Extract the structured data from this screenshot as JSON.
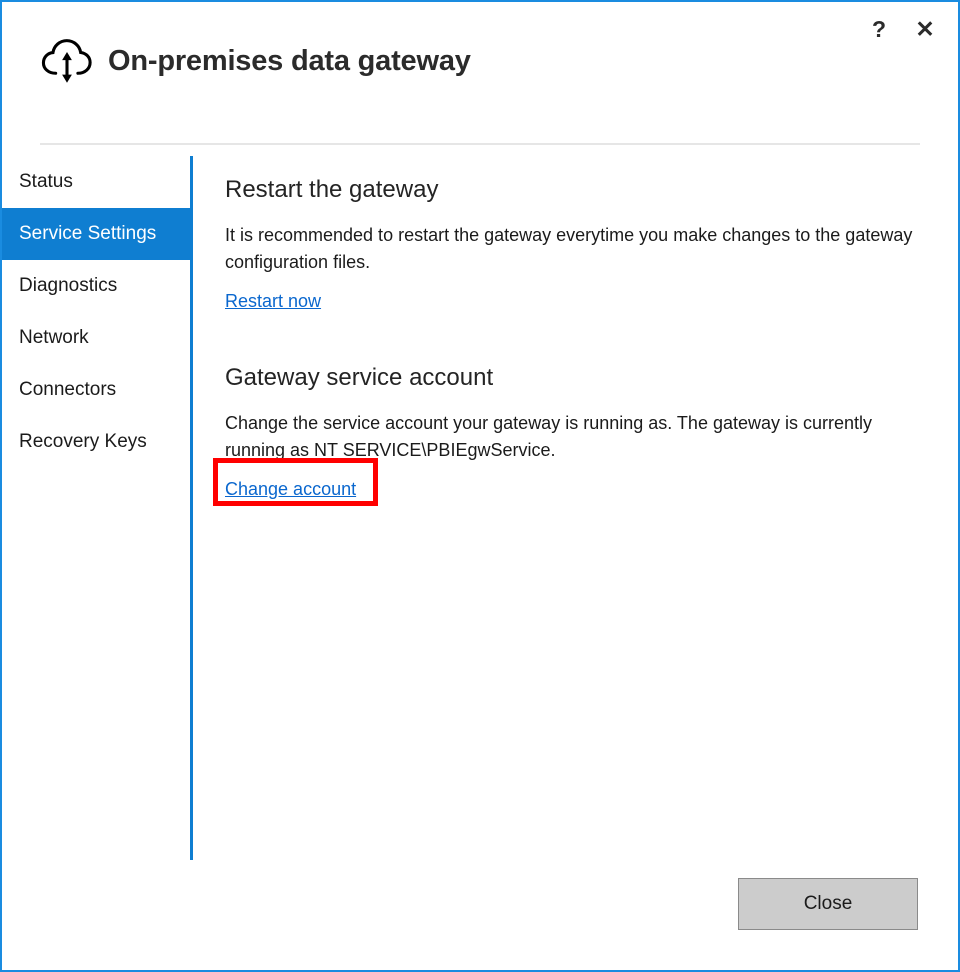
{
  "window": {
    "title": "On-premises data gateway",
    "icon": "cloud-updown-arrow-icon",
    "border_color": "#1a8ce0",
    "help_label": "?",
    "close_label": "✕"
  },
  "sidebar": {
    "items": [
      {
        "label": "Status",
        "selected": false
      },
      {
        "label": "Service Settings",
        "selected": true
      },
      {
        "label": "Diagnostics",
        "selected": false
      },
      {
        "label": "Network",
        "selected": false
      },
      {
        "label": "Connectors",
        "selected": false
      },
      {
        "label": "Recovery Keys",
        "selected": false
      }
    ],
    "selected_color": "#0f7ed1"
  },
  "main": {
    "restart_section": {
      "heading": "Restart the gateway",
      "body": "It is recommended to restart the gateway everytime you make changes to the gateway configuration files.",
      "link": "Restart now"
    },
    "service_account_section": {
      "heading": "Gateway service account",
      "body": "Change the service account your gateway is running as. The gateway is currently running as NT SERVICE\\PBIEgwService.",
      "account_name": "NT SERVICE\\PBIEgwService",
      "link": "Change account"
    }
  },
  "annotation": {
    "target": "Change account",
    "color": "#ff0000"
  },
  "footer": {
    "close_label": "Close"
  }
}
